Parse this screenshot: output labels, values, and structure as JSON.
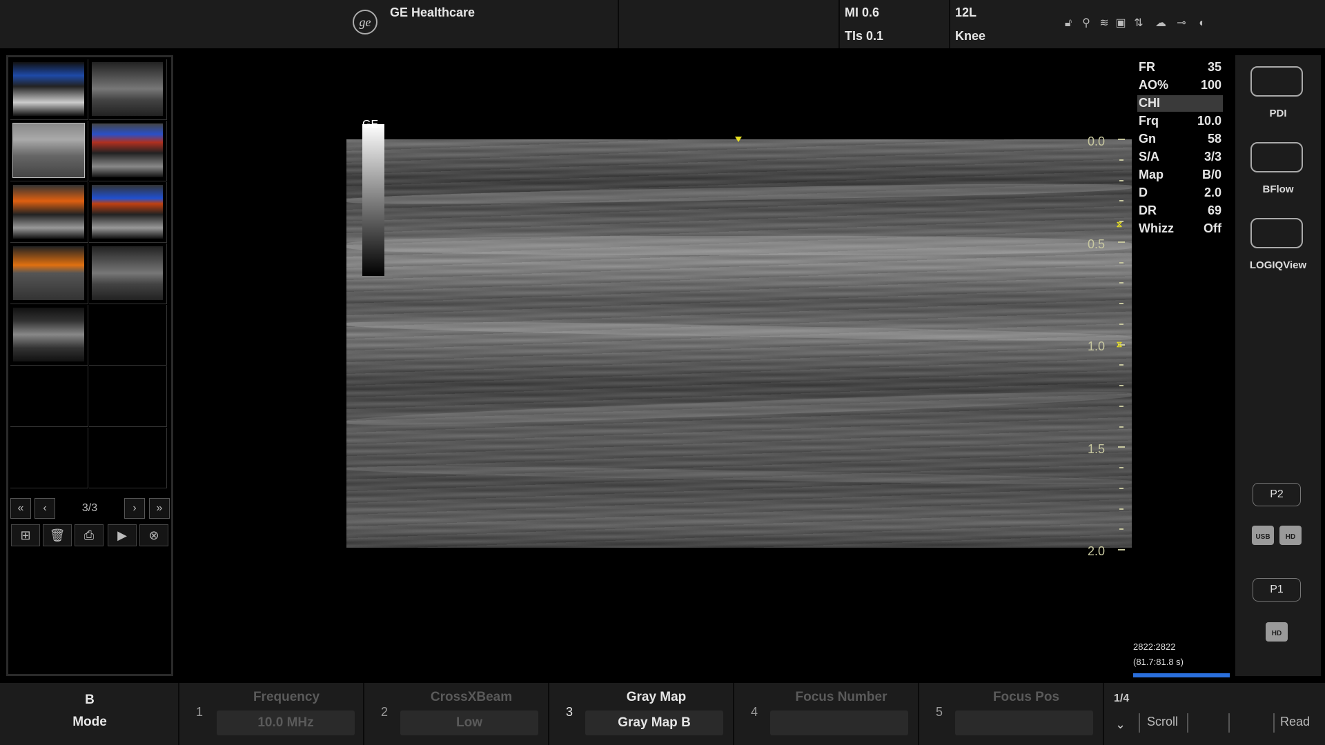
{
  "header": {
    "brand": "GE Healthcare",
    "mi": "MI 0.6",
    "tis": "TIs 0.1",
    "probe": "12L",
    "preset": "Knee"
  },
  "thumbnails": {
    "page_indicator": "3/3"
  },
  "image": {
    "scale_mark": "GE",
    "depth_labels": [
      "0.0",
      "0.5",
      "1.0",
      "1.5",
      "2.0"
    ]
  },
  "params": [
    {
      "key": "FR",
      "value": "35"
    },
    {
      "key": "AO%",
      "value": "100"
    },
    {
      "key": "CHI",
      "value": ""
    },
    {
      "key": "Frq",
      "value": "10.0"
    },
    {
      "key": "Gn",
      "value": "58"
    },
    {
      "key": "S/A",
      "value": "3/3"
    },
    {
      "key": "Map",
      "value": "B/0"
    },
    {
      "key": "D",
      "value": "2.0"
    },
    {
      "key": "DR",
      "value": "69"
    },
    {
      "key": "Whizz",
      "value": "Off"
    }
  ],
  "cine": {
    "frames": "2822:2822",
    "time": "(81.7:81.8 s)"
  },
  "right_panel": {
    "pdi": "PDI",
    "bflow": "BFlow",
    "logiqview": "LOGIQView",
    "p2": "P2",
    "p1": "P1",
    "usb": "USB",
    "hd": "HD"
  },
  "bottom": {
    "mode_top": "B",
    "mode_bottom": "Mode",
    "controls": [
      {
        "num": "1",
        "title": "Frequency",
        "value": "10.0 MHz"
      },
      {
        "num": "2",
        "title": "CrossXBeam",
        "value": "Low"
      },
      {
        "num": "3",
        "title": "Gray Map",
        "value": "Gray Map B"
      },
      {
        "num": "4",
        "title": "Focus Number",
        "value": ""
      },
      {
        "num": "5",
        "title": "Focus Pos",
        "value": ""
      }
    ],
    "page": "1/4",
    "scroll": "Scroll",
    "read": "Read"
  },
  "colors": {
    "accent_yellow": "#e8e020",
    "cine_bar": "#2a6fdc",
    "depth_text": "#c8c8a0"
  }
}
